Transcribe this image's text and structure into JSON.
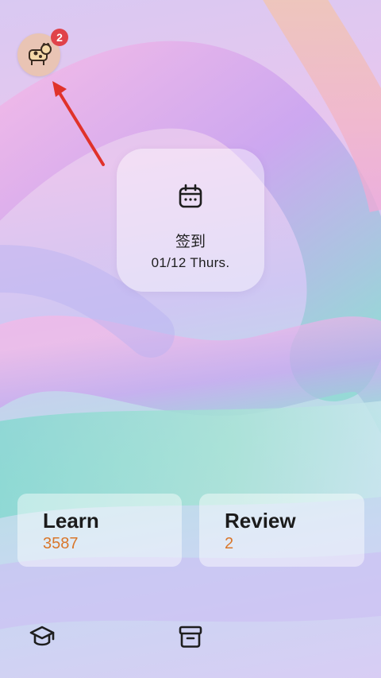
{
  "profile": {
    "avatar_icon": "cow-avatar-icon",
    "notification_count": "2"
  },
  "checkin": {
    "icon": "calendar-icon",
    "title": "签到",
    "date": "01/12 Thurs."
  },
  "stats": {
    "learn": {
      "label": "Learn",
      "value": "3587"
    },
    "review": {
      "label": "Review",
      "value": "2"
    }
  },
  "bottom_nav": [
    {
      "icon": "graduation-cap-icon"
    },
    {
      "icon": "archive-box-icon"
    }
  ],
  "colors": {
    "badge": "#e0424a",
    "accent_value": "#d9772b",
    "annotation_arrow": "#e0322b"
  }
}
